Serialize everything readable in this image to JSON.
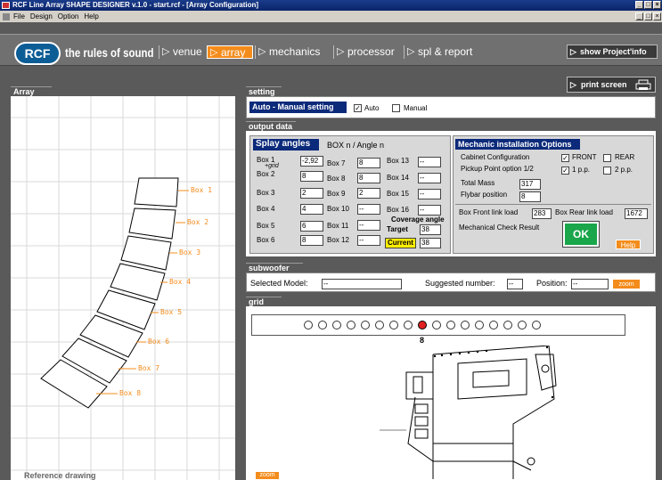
{
  "window": {
    "title": "RCF Line Array SHAPE DESIGNER v.1.0 - start.rcf - [Array Configuration]",
    "menu": [
      "File",
      "Design",
      "Option",
      "Help"
    ],
    "controls": {
      "minimize": "_",
      "maximize": "□",
      "close": "×"
    }
  },
  "nav": {
    "logo": "RCF",
    "slogan": "the rules of sound",
    "tabs": [
      {
        "label": "venue",
        "selected": false
      },
      {
        "label": "array",
        "selected": true
      },
      {
        "label": "mechanics",
        "selected": false
      },
      {
        "label": "processor",
        "selected": false
      },
      {
        "label": "spl & report",
        "selected": false
      }
    ],
    "show_project_info": "show Project'info",
    "print_screen": "print screen"
  },
  "array_panel": {
    "title": "Array",
    "box_labels": [
      "Box 1",
      "Box 2",
      "Box 3",
      "Box 4",
      "Box 5",
      "Box 6",
      "Box 7",
      "Box 8"
    ],
    "reference": "Reference drawing"
  },
  "setting": {
    "title": "setting",
    "mode_label": "Auto - Manual setting",
    "auto_label": "Auto",
    "auto_checked": true,
    "manual_label": "Manual",
    "manual_checked": false
  },
  "output": {
    "title": "output data",
    "splay_title": "Splay angles",
    "splay_subtitle": "BOX n / Angle n",
    "grid_note": "+grid",
    "boxes": [
      {
        "label": "Box 1",
        "value": "-2,92"
      },
      {
        "label": "Box 2",
        "value": "8"
      },
      {
        "label": "Box 3",
        "value": "2"
      },
      {
        "label": "Box 4",
        "value": "4"
      },
      {
        "label": "Box 5",
        "value": "6"
      },
      {
        "label": "Box 6",
        "value": "8"
      },
      {
        "label": "Box 7",
        "value": "8"
      },
      {
        "label": "Box 8",
        "value": "8"
      },
      {
        "label": "Box 9",
        "value": "2"
      },
      {
        "label": "Box 10",
        "value": "--"
      },
      {
        "label": "Box 11",
        "value": "--"
      },
      {
        "label": "Box 12",
        "value": "--"
      },
      {
        "label": "Box 13",
        "value": "--"
      },
      {
        "label": "Box 14",
        "value": "--"
      },
      {
        "label": "Box 15",
        "value": "--"
      },
      {
        "label": "Box 16",
        "value": "--"
      }
    ],
    "coverage_title": "Coverage angle",
    "target_label": "Target",
    "target_value": "38",
    "current_label": "Current",
    "current_value": "38"
  },
  "mechanic": {
    "title": "Mechanic installation Options",
    "cabinet_label": "Cabinet Configuration",
    "front_label": "FRONT",
    "front_checked": true,
    "rear_label": "REAR",
    "rear_checked": false,
    "pickup_label": "Pickup Point option 1/2",
    "pp1_label": "1 p.p.",
    "pp1_checked": true,
    "pp2_label": "2 p.p.",
    "pp2_checked": false,
    "total_mass_label": "Total Mass",
    "total_mass_value": "317",
    "flybar_label": "Flybar position",
    "flybar_value": "8",
    "front_link_label": "Box Front link load",
    "front_link_value": "283",
    "rear_link_label": "Box Rear link load",
    "rear_link_value": "1672",
    "check_label": "Mechanical Check Result",
    "ok_label": "OK",
    "help_label": "Help"
  },
  "subwoofer": {
    "title": "subwoofer",
    "selected_label": "Selected Model:",
    "selected_value": "--",
    "suggested_label": "Suggested number:",
    "suggested_value": "--",
    "position_label": "Position:",
    "position_value": "--",
    "zoom_label": "zoom"
  },
  "grid": {
    "title": "grid",
    "hole_count": 17,
    "selected_hole": 9,
    "selected_label": "8",
    "zoom_label": "zoom"
  },
  "colors": {
    "accent": "#f48c1c",
    "header_blue": "#0c2a7a",
    "ok_green": "#1aa64a",
    "selected_red": "#e02020"
  }
}
